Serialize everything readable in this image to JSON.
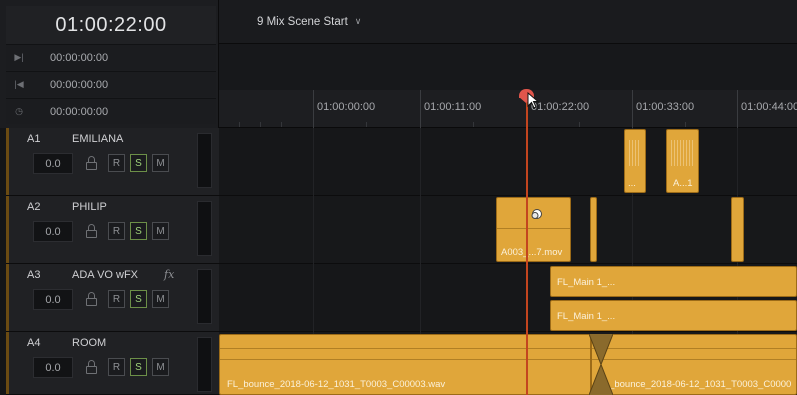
{
  "timecode": {
    "main": "01:00:22:00",
    "rows": [
      {
        "icon": "play-next-icon",
        "glyph": "▶|",
        "value": "00:00:00:00"
      },
      {
        "icon": "play-prev-icon",
        "glyph": "|◀",
        "value": "00:00:00:00"
      },
      {
        "icon": "clock-icon",
        "glyph": "◷",
        "value": "00:00:00:00"
      }
    ]
  },
  "timeline": {
    "title": "9 Mix Scene Start",
    "dropdown_glyph": "∨"
  },
  "ruler": {
    "labels": [
      "01:00:00:00",
      "01:00:11:00",
      "01:00:22:00",
      "01:00:33:00",
      "01:00:44:00"
    ]
  },
  "tracks": [
    {
      "id": "A1",
      "name": "EMILIANA",
      "fx": "",
      "volume": "0.0",
      "r_label": "R",
      "s_label": "S",
      "m_label": "M"
    },
    {
      "id": "A2",
      "name": "PHILIP",
      "fx": "",
      "volume": "0.0",
      "r_label": "R",
      "s_label": "S",
      "m_label": "M"
    },
    {
      "id": "A3",
      "name": "ADA VO wFX",
      "fx": "fx",
      "volume": "0.0",
      "r_label": "R",
      "s_label": "S",
      "m_label": "M"
    },
    {
      "id": "A4",
      "name": "ROOM",
      "fx": "",
      "volume": "0.0",
      "r_label": "R",
      "s_label": "S",
      "m_label": "M"
    }
  ],
  "clips": {
    "a1_clip1": "...",
    "a1_clip2": "A...1",
    "a2_clip1": "A003_...7.mov",
    "a3_clip1": "FL_Main 1_...",
    "a3_clip2": "FL_Main 1_...",
    "a4_clip1": "FL_bounce_2018-06-12_1031_T0003_C00003.wav",
    "a4_clip2": "FL_bounce_2018-06-12_1031_T0003_C0000"
  },
  "colors": {
    "clip": "#e0a63a",
    "playhead": "#e0554b",
    "solo_active": "#9fd27a"
  }
}
